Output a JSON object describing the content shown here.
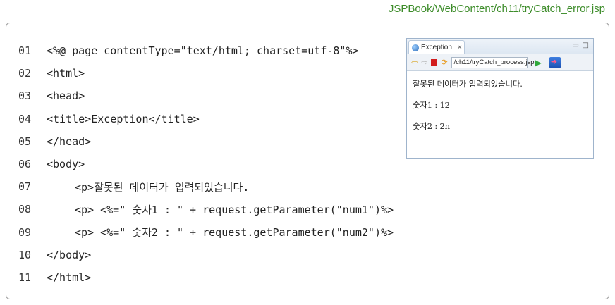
{
  "file_path": "JSPBook/WebContent/ch11/tryCatch_error.jsp",
  "code": {
    "lines": [
      {
        "no": "01",
        "text": "<%@ page contentType=\"text/html; charset=utf-8\"%>",
        "indent": false
      },
      {
        "no": "02",
        "text": "<html>",
        "indent": false
      },
      {
        "no": "03",
        "text": "<head>",
        "indent": false
      },
      {
        "no": "04",
        "text": "<title>Exception</title>",
        "indent": false
      },
      {
        "no": "05",
        "text": "</head>",
        "indent": false
      },
      {
        "no": "06",
        "text": "<body>",
        "indent": false
      },
      {
        "no": "07",
        "text": "<p>잘못된 데이터가 입력되었습니다.",
        "indent": true
      },
      {
        "no": "08",
        "text": "<p> <%=\" 숫자1 : \" + request.getParameter(\"num1\")%>",
        "indent": true
      },
      {
        "no": "09",
        "text": "<p> <%=\" 숫자2 : \" + request.getParameter(\"num2\")%>",
        "indent": true
      },
      {
        "no": "10",
        "text": "</body>",
        "indent": false
      },
      {
        "no": "11",
        "text": "</html>",
        "indent": false
      }
    ]
  },
  "browser": {
    "tab_title": "Exception",
    "tab_close": "✕",
    "win_min": "▭",
    "win_max": "□",
    "url": "/ch11/tryCatch_process.jsp",
    "content": {
      "line1": "잘못된 데이터가 입력되었습니다.",
      "line2": "숫자1 : 12",
      "line3": "숫자2 : 2n"
    }
  },
  "colors": {
    "file_path": "#3d8c2a",
    "border": "#9a9a9a"
  }
}
